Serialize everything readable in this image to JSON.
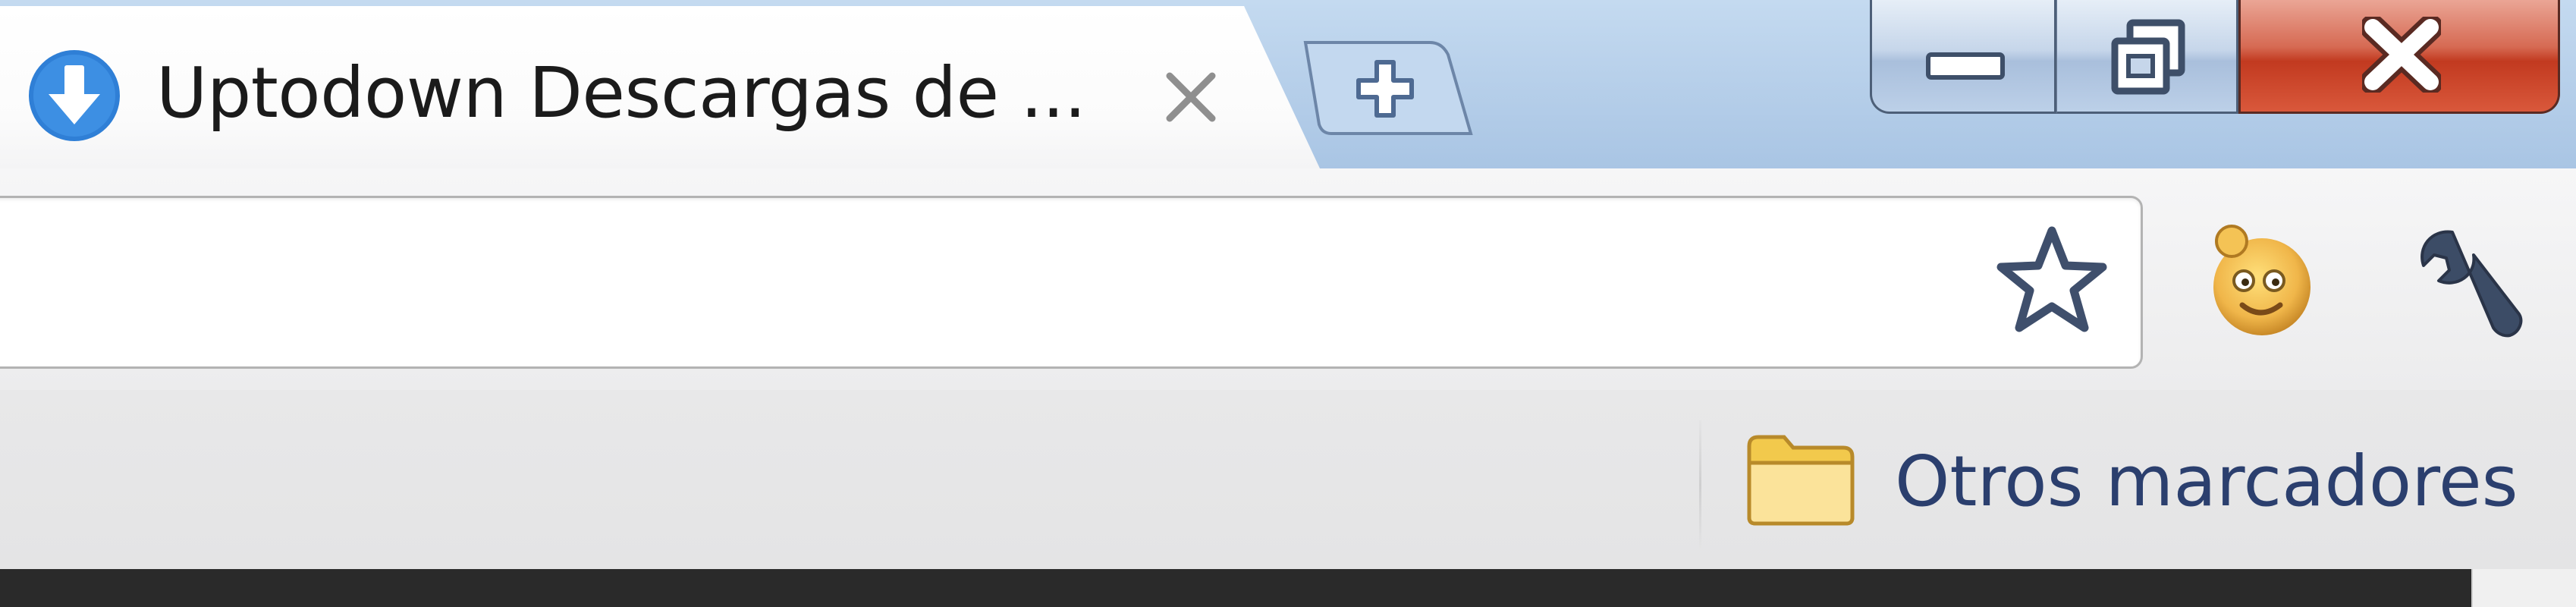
{
  "tab": {
    "title": "Uptodown Descargas de ...",
    "favicon": "uptodown-download-icon",
    "close_icon": "close-icon"
  },
  "new_tab": {
    "icon": "plus-icon"
  },
  "window_controls": {
    "minimize_icon": "minimize-icon",
    "maximize_icon": "restore-icon",
    "close_icon": "close-x-icon"
  },
  "omnibox": {
    "value": "",
    "placeholder": ""
  },
  "toolbar": {
    "bookmark_star_icon": "star-icon",
    "extension_icon": "smiley-extension-icon",
    "menu_icon": "wrench-icon"
  },
  "bookmarks_bar": {
    "other_bookmarks_label": "Otros marcadores",
    "folder_icon": "folder-icon"
  },
  "colors": {
    "titlebar": "#b5cee9",
    "close_button": "#c23a20",
    "bookmark_text": "#2b3f6e",
    "favicon_blue": "#2f7fd6",
    "folder_yellow": "#f2c94c"
  }
}
